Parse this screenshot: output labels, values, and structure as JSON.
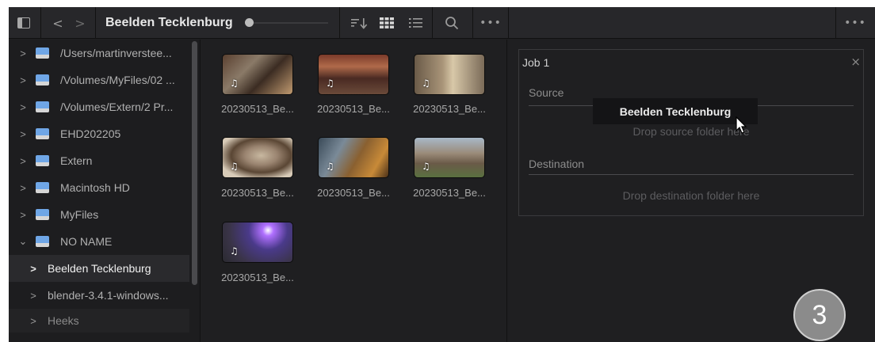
{
  "toolbar": {
    "path_title": "Beelden Tecklenburg",
    "icons": {
      "sidebar_toggle": "sidebar-toggle-icon",
      "back": "chevron-left-icon",
      "forward": "chevron-right-icon",
      "sort": "sort-icon",
      "grid": "grid-view-icon",
      "list": "list-view-icon",
      "search": "search-icon",
      "more": "more-icon"
    },
    "back_glyph": "<",
    "forward_glyph": ">",
    "more_glyph": "•••"
  },
  "sidebar": {
    "items": [
      {
        "label": "/Users/martinverstee...",
        "expanded": false
      },
      {
        "label": "/Volumes/MyFiles/02 ...",
        "expanded": false
      },
      {
        "label": "/Volumes/Extern/2 Pr...",
        "expanded": false
      },
      {
        "label": "EHD202205",
        "expanded": false
      },
      {
        "label": "Extern",
        "expanded": false
      },
      {
        "label": "Macintosh HD",
        "expanded": false
      },
      {
        "label": "MyFiles",
        "expanded": false
      },
      {
        "label": "NO NAME",
        "expanded": true
      }
    ],
    "children": [
      {
        "label": "Beelden Tecklenburg",
        "selected": true
      },
      {
        "label": "blender-3.4.1-windows...",
        "selected": false
      },
      {
        "label": "Heeks",
        "selected": false
      }
    ]
  },
  "browser": {
    "clips": [
      {
        "label": "20230513_Be...",
        "type": "audio-clip"
      },
      {
        "label": "20230513_Be...",
        "type": "audio-clip"
      },
      {
        "label": "20230513_Be...",
        "type": "audio-clip"
      },
      {
        "label": "20230513_Be...",
        "type": "audio-clip"
      },
      {
        "label": "20230513_Be...",
        "type": "audio-clip"
      },
      {
        "label": "20230513_Be...",
        "type": "audio-clip"
      },
      {
        "label": "20230513_Be...",
        "type": "audio-clip"
      }
    ]
  },
  "job": {
    "title": "Job 1",
    "close_glyph": "×",
    "source_label": "Source",
    "source_placeholder": "Drop source folder here",
    "destination_label": "Destination",
    "destination_placeholder": "Drop destination folder here"
  },
  "drag": {
    "tooltip": "Beelden Tecklenburg"
  },
  "badge": {
    "step": "3"
  }
}
